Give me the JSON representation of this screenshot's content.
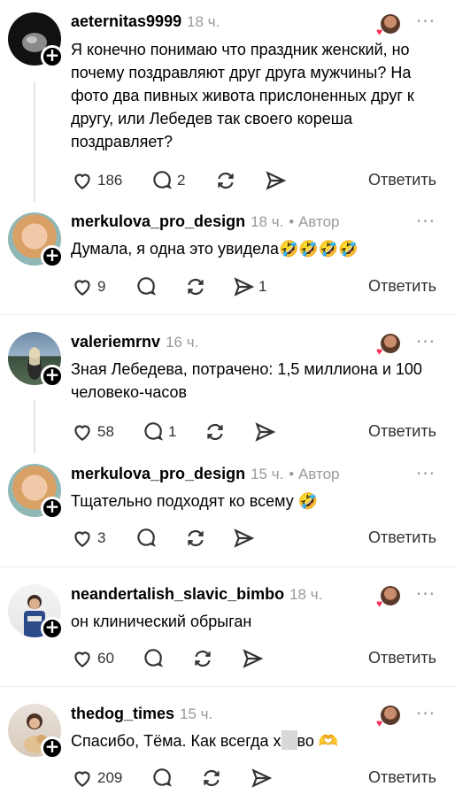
{
  "comments": [
    {
      "username": "aeternitas9999",
      "time": "18 ч.",
      "author": "",
      "lines": [
        "Я конечно понимаю что праздник женский, но",
        "почему поздравляют друг друга мужчины? На",
        "фото два пивных живота прислоненных друг к",
        "другу, или Лебедев так своего кореша",
        "поздравляет?"
      ],
      "likes": "186",
      "replies": "2",
      "reposts": "",
      "shares": "",
      "reply_label": "Ответить"
    },
    {
      "username": "merkulova_pro_design",
      "time": "18 ч.",
      "author": "• Автор",
      "lines": [
        "Думала, я одна это увидела🤣🤣🤣🤣"
      ],
      "likes": "9",
      "replies": "",
      "reposts": "",
      "shares": "1",
      "reply_label": "Ответить"
    },
    {
      "username": "valeriemrnv",
      "time": "16 ч.",
      "author": "",
      "lines": [
        "Зная Лебедева, потрачено: 1,5 миллиона и 100",
        "человеко-часов"
      ],
      "likes": "58",
      "replies": "1",
      "reposts": "",
      "shares": "",
      "reply_label": "Ответить"
    },
    {
      "username": "merkulova_pro_design",
      "time": "15 ч.",
      "author": "• Автор",
      "lines": [
        "Тщательно подходят ко всему 🤣"
      ],
      "likes": "3",
      "replies": "",
      "reposts": "",
      "shares": "",
      "reply_label": "Ответить"
    },
    {
      "username": "neandertalish_slavic_bimbo",
      "time": "18 ч.",
      "author": "",
      "lines": [
        "он клинический обрыган"
      ],
      "likes": "60",
      "replies": "",
      "reposts": "",
      "shares": "",
      "reply_label": "Ответить"
    },
    {
      "username": "thedog_times",
      "time": "15 ч.",
      "author": "",
      "text_pre": "Спасибо, Тёма. Как всегда х",
      "text_post": "во 🫶",
      "likes": "209",
      "replies": "",
      "reposts": "",
      "shares": "",
      "reply_label": "Ответить"
    }
  ],
  "icons": {
    "like": "heart-outline-icon",
    "reply": "speech-bubble-icon",
    "repost": "repost-arrows-icon",
    "share": "paper-plane-icon",
    "more": "more-horizontal-icon",
    "follow": "plus-icon"
  },
  "colors": {
    "muted": "#9a9a9a",
    "heart_badge": "#ff2d55",
    "divider": "#ececec"
  }
}
